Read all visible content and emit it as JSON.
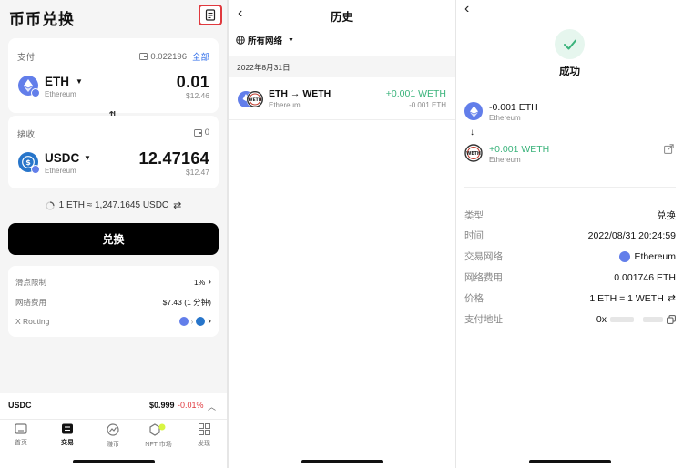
{
  "swap": {
    "title": "币币兑换",
    "pay": {
      "label": "支付",
      "balance": "0.022196",
      "all_label": "全部",
      "symbol": "ETH",
      "network": "Ethereum",
      "amount": "0.01",
      "usd": "$12.46"
    },
    "receive": {
      "label": "接收",
      "balance": "0",
      "symbol": "USDC",
      "network": "Ethereum",
      "amount": "12.47164",
      "usd": "$12.47"
    },
    "rate": "1 ETH ≈ 1,247.1645 USDC",
    "button_label": "兑换",
    "settings": {
      "slippage_label": "滑点限制",
      "slippage_value": "1%",
      "fee_label": "网络费用",
      "fee_value": "$7.43 (1 分钟)",
      "routing_label": "X Routing"
    },
    "ticker": {
      "symbol": "USDC",
      "price": "$0.999",
      "change": "-0.01%"
    },
    "tabs": [
      "首页",
      "交易",
      "赚币",
      "NFT 市场",
      "发现"
    ]
  },
  "history": {
    "title": "历史",
    "network_filter": "所有网络",
    "date": "2022年8月31日",
    "item": {
      "title": "ETH → WETH",
      "network": "Ethereum",
      "amount_in": "+0.001 WETH",
      "amount_out": "-0.001 ETH"
    }
  },
  "detail": {
    "status": "成功",
    "from": {
      "amount": "-0.001 ETH",
      "network": "Ethereum"
    },
    "to": {
      "amount": "+0.001 WETH",
      "network": "Ethereum"
    },
    "rows": {
      "type_label": "类型",
      "type_value": "兑换",
      "time_label": "时间",
      "time_value": "2022/08/31 20:24:59",
      "network_label": "交易网络",
      "network_value": "Ethereum",
      "fee_label": "网络费用",
      "fee_value": "0.001746 ETH",
      "price_label": "价格",
      "price_value": "1 ETH = 1 WETH",
      "address_label": "支付地址",
      "address_value": "0x"
    }
  },
  "colors": {
    "accent": "#2a6ae9",
    "positive": "#3ab37b",
    "negative": "#e0393e",
    "highlight_border": "#e0393e",
    "eth": "#627eea",
    "usdc": "#2775ca"
  }
}
